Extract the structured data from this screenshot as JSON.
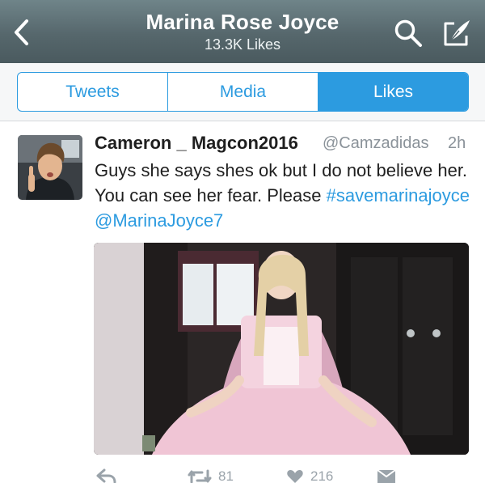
{
  "header": {
    "title": "Marina Rose Joyce",
    "subtitle": "13.3K Likes",
    "back_icon": "chevron-left-icon",
    "search_icon": "search-icon",
    "compose_icon": "compose-icon"
  },
  "tabs": [
    {
      "label": "Tweets",
      "active": false
    },
    {
      "label": "Media",
      "active": false
    },
    {
      "label": "Likes",
      "active": true
    }
  ],
  "tweet": {
    "author_name": "Cameron _ Magcon2016",
    "handle": "@Camzadidas",
    "time": "2h",
    "text_plain": "Guys she says shes ok but I do not believe her. You can see her fear. Please",
    "hashtag": "#savemarinajoyce",
    "mention": "@MarinaJoyce7",
    "retweets": "81",
    "likes": "216"
  },
  "colors": {
    "accent": "#2c9be0",
    "header_top": "#6f8489",
    "header_bottom": "#4a5a5f",
    "muted": "#8a9299"
  }
}
